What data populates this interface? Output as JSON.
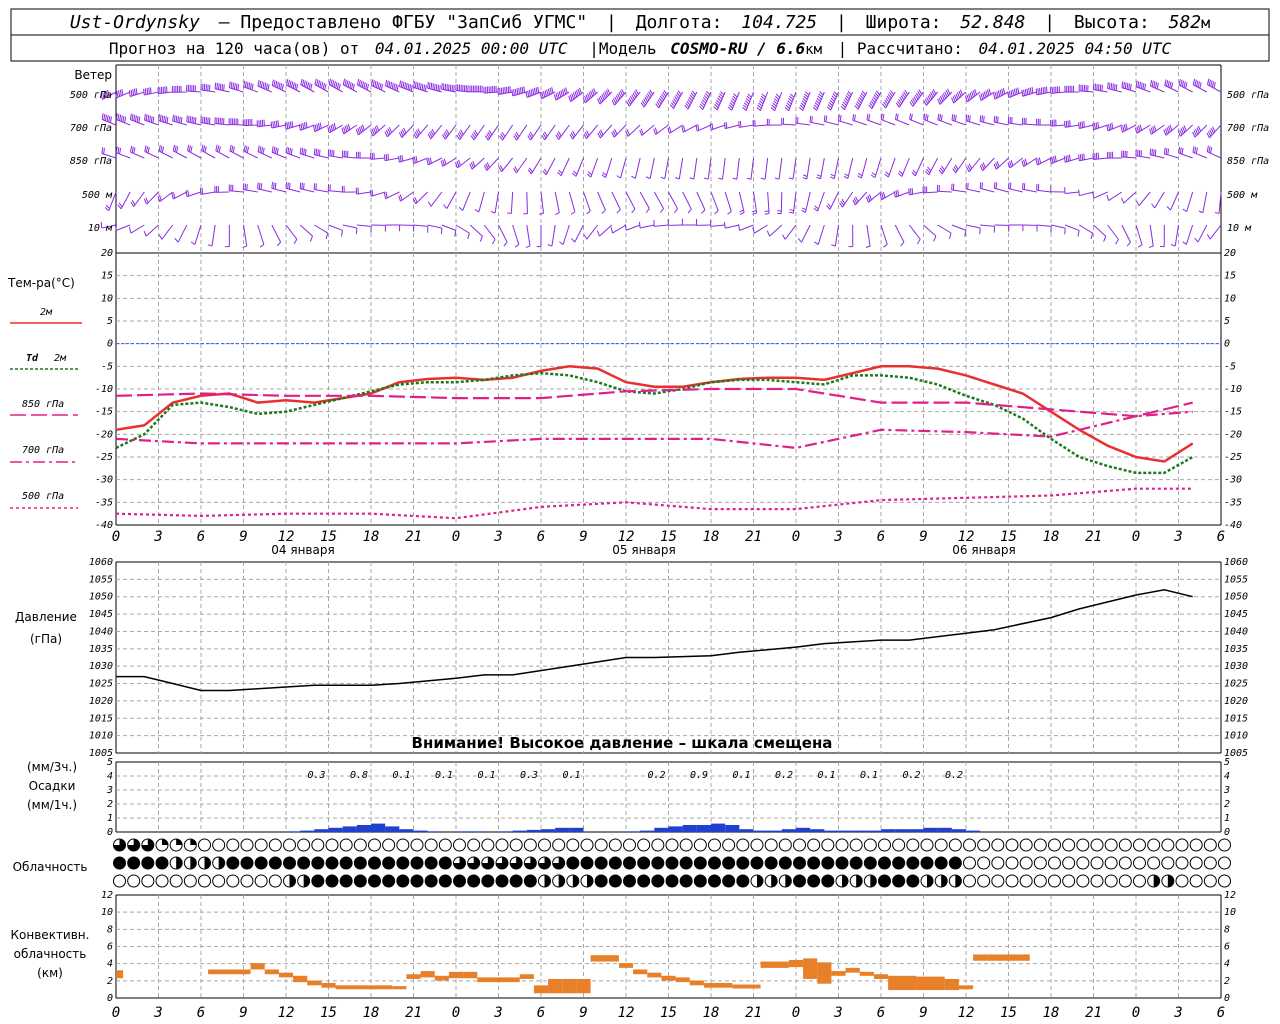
{
  "header": {
    "line1": {
      "station": "Ust-Ordynsky",
      "provided": "— Предоставлено ФГБУ \"ЗапСиб УГМС\"",
      "lon_label": "Долгота:",
      "lon": "104.725",
      "lat_label": "Широта:",
      "lat": "52.848",
      "alt_label": "Высота:",
      "alt": "582",
      "alt_unit": "м"
    },
    "line2": {
      "forecast": "Прогноз на 120 часа(ов) от",
      "run": "04.01.2025 00:00 UTC",
      "model_label": "|Модель",
      "model": "COSMO-RU / 6.6",
      "model_unit": "км",
      "calc_label": "| Рассчитано:",
      "calc": "04.01.2025 04:50 UTC"
    }
  },
  "wind_panel": {
    "title": "Ветер",
    "levels": [
      "500 гПа",
      "700 гПа",
      "850 гПа",
      "500 м",
      "10  м"
    ],
    "barb_color": "#8a2be2"
  },
  "temp_panel": {
    "title": "Тем-ра(°С)",
    "legend": [
      {
        "key": "t2m",
        "label": "2м",
        "color": "#e83030",
        "dash": ""
      },
      {
        "key": "td",
        "label_it": "Td",
        "label": "2м",
        "color": "#1c7a1c",
        "dash": "3 2"
      },
      {
        "key": "t850",
        "label": "850 гПа",
        "color": "#e0208a",
        "dash": "16 5"
      },
      {
        "key": "t700",
        "label": "700 гПа",
        "color": "#e0208a",
        "dash": "12 4 3 4"
      },
      {
        "key": "t500",
        "label": "500 гПа",
        "color": "#e0208a",
        "dash": "3 3"
      }
    ],
    "y_ticks": [
      "20",
      "15",
      "10",
      "5",
      "0",
      "-5",
      "-10",
      "-15",
      "-20",
      "-25",
      "-30",
      "-35",
      "-40"
    ],
    "dates": [
      "04 января",
      "05 января",
      "06 января"
    ]
  },
  "x_ticks": [
    "0",
    "3",
    "6",
    "9",
    "12",
    "15",
    "18",
    "21",
    "0",
    "3",
    "6",
    "9",
    "12",
    "15",
    "18",
    "21",
    "0",
    "3",
    "6",
    "9",
    "12",
    "15",
    "18",
    "21",
    "0",
    "3",
    "6"
  ],
  "pressure_panel": {
    "title": "Давление",
    "unit": "(гПа)",
    "y_ticks": [
      "1060",
      "1055",
      "1050",
      "1045",
      "1040",
      "1035",
      "1030",
      "1025",
      "1020",
      "1015",
      "1010",
      "1005"
    ],
    "warning": "Внимание! Высокое давление – шкала смещена"
  },
  "precip_panel": {
    "unit3": "(мм/3ч.)",
    "title": "Осадки",
    "unit1": "(мм/1ч.)",
    "y_ticks": [
      "5",
      "4",
      "3",
      "2",
      "1",
      "0"
    ],
    "color": "#2040d0",
    "amounts": [
      {
        "h": 15,
        "v": "0.3"
      },
      {
        "h": 18,
        "v": "0.8"
      },
      {
        "h": 21,
        "v": "0.1"
      },
      {
        "h": 24,
        "v": "0.1"
      },
      {
        "h": 27,
        "v": "0.1"
      },
      {
        "h": 30,
        "v": "0.3"
      },
      {
        "h": 33,
        "v": "0.1"
      },
      {
        "h": 39,
        "v": "0.2"
      },
      {
        "h": 42,
        "v": "0.9"
      },
      {
        "h": 45,
        "v": "0.1"
      },
      {
        "h": 48,
        "v": "0.2"
      },
      {
        "h": 51,
        "v": "0.1"
      },
      {
        "h": 54,
        "v": "0.1"
      },
      {
        "h": 57,
        "v": "0.2"
      },
      {
        "h": 60,
        "v": "0.2"
      }
    ]
  },
  "cloud_panel": {
    "title": "Облачность"
  },
  "conv_panel": {
    "title1": "Конвективн.",
    "title2": "облачность",
    "unit": "(км)",
    "y_ticks": [
      "12",
      "10",
      "8",
      "6",
      "4",
      "2",
      "0"
    ],
    "color": "#e8802a"
  },
  "chart_data": [
    {
      "type": "line",
      "title": "Тем-ра(°С)",
      "x_unit": "hours since 04.01.2025 00:00 UTC",
      "ylim": [
        -40,
        20
      ],
      "series": [
        {
          "name": "2м",
          "x": [
            0,
            2,
            4,
            6,
            8,
            10,
            12,
            14,
            16,
            18,
            20,
            22,
            24,
            26,
            28,
            30,
            32,
            34,
            36,
            38,
            40,
            42,
            44,
            46,
            48,
            50,
            52,
            54,
            56,
            58,
            60,
            62,
            64,
            66,
            68,
            70,
            72,
            74,
            76
          ],
          "values": [
            -19,
            -18,
            -13,
            -11.5,
            -11,
            -13,
            -12.5,
            -13,
            -12,
            -11,
            -8.5,
            -7.8,
            -7.5,
            -8,
            -7.5,
            -6,
            -5,
            -5.5,
            -8.5,
            -9.5,
            -9.5,
            -8.5,
            -7.8,
            -7.5,
            -7.5,
            -8,
            -6.5,
            -5,
            -5,
            -5.5,
            -7,
            -9,
            -11,
            -15,
            -19,
            -22.5,
            -25,
            -26,
            -22
          ]
        },
        {
          "name": "Td 2м",
          "x": [
            0,
            2,
            4,
            6,
            8,
            10,
            12,
            14,
            16,
            18,
            20,
            22,
            24,
            26,
            28,
            30,
            32,
            34,
            36,
            38,
            40,
            42,
            44,
            46,
            48,
            50,
            52,
            54,
            56,
            58,
            60,
            62,
            64,
            66,
            68,
            70,
            72,
            74,
            76
          ],
          "values": [
            -23,
            -20,
            -13.5,
            -13,
            -14,
            -15.5,
            -15,
            -13.5,
            -12,
            -10.5,
            -9,
            -8.5,
            -8.5,
            -8,
            -7,
            -6.5,
            -7,
            -8.5,
            -10.5,
            -11,
            -10,
            -8.5,
            -8,
            -8,
            -8.5,
            -9,
            -7,
            -7,
            -7.5,
            -9,
            -11.5,
            -13.5,
            -16.5,
            -21,
            -25,
            -27,
            -28.5,
            -28.5,
            -25
          ]
        },
        {
          "name": "850 гПа",
          "x": [
            0,
            6,
            12,
            18,
            24,
            30,
            36,
            42,
            48,
            54,
            60,
            66,
            72,
            76
          ],
          "values": [
            -11.5,
            -11,
            -11.5,
            -11.5,
            -12,
            -12,
            -10.5,
            -10,
            -10,
            -13,
            -13,
            -14.5,
            -16,
            -13
          ]
        },
        {
          "name": "700 гПа",
          "x": [
            0,
            6,
            12,
            18,
            24,
            30,
            36,
            42,
            48,
            54,
            60,
            66,
            72,
            76
          ],
          "values": [
            -21,
            -22,
            -22,
            -22,
            -22,
            -21,
            -21,
            -21,
            -23,
            -19,
            -19.5,
            -20.5,
            -16,
            -15
          ]
        },
        {
          "name": "500 гПа",
          "x": [
            0,
            6,
            12,
            18,
            24,
            30,
            36,
            42,
            48,
            54,
            60,
            66,
            72,
            76
          ],
          "values": [
            -37.5,
            -38,
            -37.5,
            -37.5,
            -38.5,
            -36,
            -35,
            -36.5,
            -36.5,
            -34.5,
            -34,
            -33.5,
            -32,
            -32
          ]
        }
      ]
    },
    {
      "type": "line",
      "title": "Давление",
      "ylabel": "(гПа)",
      "ylim": [
        1005,
        1060
      ],
      "series": [
        {
          "name": "Давление",
          "x": [
            0,
            2,
            4,
            6,
            8,
            12,
            14,
            18,
            20,
            24,
            26,
            28,
            32,
            36,
            38,
            42,
            44,
            48,
            50,
            54,
            56,
            60,
            62,
            66,
            68,
            72,
            74,
            76
          ],
          "values": [
            1027,
            1027,
            1025,
            1023,
            1023,
            1024,
            1024.5,
            1024.5,
            1025,
            1026.5,
            1027.5,
            1027.5,
            1030,
            1032.5,
            1032.5,
            1033,
            1034,
            1035.5,
            1036.5,
            1037.5,
            1037.5,
            1039.5,
            1040.5,
            1044,
            1046.5,
            1050.5,
            1052,
            1050
          ]
        }
      ]
    },
    {
      "type": "bar",
      "title": "Осадки",
      "ylabel": "(мм/1ч.)",
      "ylim": [
        0,
        5
      ],
      "x": [
        12,
        13,
        14,
        15,
        16,
        17,
        18,
        19,
        20,
        21,
        22,
        24,
        25,
        27,
        28,
        29,
        30,
        31,
        32,
        36,
        37,
        38,
        39,
        40,
        41,
        42,
        43,
        44,
        45,
        46,
        47,
        48,
        49,
        50,
        51,
        52,
        53,
        54,
        55,
        56,
        57,
        58,
        59,
        60
      ],
      "values": [
        0.05,
        0.1,
        0.2,
        0.3,
        0.4,
        0.5,
        0.6,
        0.4,
        0.2,
        0.1,
        0.05,
        0.05,
        0.05,
        0.05,
        0.1,
        0.15,
        0.2,
        0.3,
        0.3,
        0.05,
        0.1,
        0.3,
        0.4,
        0.5,
        0.5,
        0.6,
        0.5,
        0.2,
        0.1,
        0.1,
        0.2,
        0.3,
        0.2,
        0.1,
        0.1,
        0.1,
        0.1,
        0.2,
        0.2,
        0.2,
        0.3,
        0.3,
        0.2,
        0.1
      ]
    },
    {
      "type": "bar",
      "title": "Конвективн. облачность",
      "ylabel": "(км)",
      "ylim": [
        0,
        14
      ],
      "bars": [
        {
          "x0": 0,
          "x1": 0.5,
          "lo": 2.5,
          "hi": 3.5
        },
        {
          "x0": 6.5,
          "x1": 9.5,
          "lo": 3.0,
          "hi": 3.6
        },
        {
          "x0": 9.5,
          "x1": 10.5,
          "lo": 3.6,
          "hi": 4.4
        },
        {
          "x0": 10.5,
          "x1": 11.5,
          "lo": 3.0,
          "hi": 3.6
        },
        {
          "x0": 11.5,
          "x1": 12.5,
          "lo": 2.6,
          "hi": 3.2
        },
        {
          "x0": 12.5,
          "x1": 13.5,
          "lo": 2.0,
          "hi": 2.8
        },
        {
          "x0": 13.5,
          "x1": 14.5,
          "lo": 1.6,
          "hi": 2.2
        },
        {
          "x0": 14.5,
          "x1": 15.5,
          "lo": 1.3,
          "hi": 1.9
        },
        {
          "x0": 15.5,
          "x1": 19.5,
          "lo": 1.1,
          "hi": 1.6
        },
        {
          "x0": 19.5,
          "x1": 20.5,
          "lo": 1.1,
          "hi": 1.5
        },
        {
          "x0": 20.5,
          "x1": 21.5,
          "lo": 2.4,
          "hi": 3.0
        },
        {
          "x0": 21.5,
          "x1": 22.5,
          "lo": 2.6,
          "hi": 3.4
        },
        {
          "x0": 22.5,
          "x1": 23.5,
          "lo": 2.2,
          "hi": 2.8
        },
        {
          "x0": 23.5,
          "x1": 24.5,
          "lo": 2.5,
          "hi": 3.3
        },
        {
          "x0": 24.5,
          "x1": 25.5,
          "lo": 2.5,
          "hi": 3.3
        },
        {
          "x0": 25.5,
          "x1": 28.5,
          "lo": 2.0,
          "hi": 2.6
        },
        {
          "x0": 28.5,
          "x1": 29.5,
          "lo": 2.4,
          "hi": 3.0
        },
        {
          "x0": 29.5,
          "x1": 30.5,
          "lo": 0.6,
          "hi": 1.6
        },
        {
          "x0": 30.5,
          "x1": 31.5,
          "lo": 0.6,
          "hi": 2.4
        },
        {
          "x0": 31.5,
          "x1": 32.5,
          "lo": 0.6,
          "hi": 2.4
        },
        {
          "x0": 32.5,
          "x1": 33.5,
          "lo": 0.6,
          "hi": 2.4
        },
        {
          "x0": 33.5,
          "x1": 35.5,
          "lo": 4.6,
          "hi": 5.4
        },
        {
          "x0": 35.5,
          "x1": 36.5,
          "lo": 3.8,
          "hi": 4.4
        },
        {
          "x0": 36.5,
          "x1": 37.5,
          "lo": 3.0,
          "hi": 3.6
        },
        {
          "x0": 37.5,
          "x1": 38.5,
          "lo": 2.6,
          "hi": 3.2
        },
        {
          "x0": 38.5,
          "x1": 39.5,
          "lo": 2.2,
          "hi": 2.8
        },
        {
          "x0": 39.5,
          "x1": 40.5,
          "lo": 2.0,
          "hi": 2.6
        },
        {
          "x0": 40.5,
          "x1": 41.5,
          "lo": 1.6,
          "hi": 2.2
        },
        {
          "x0": 41.5,
          "x1": 43.5,
          "lo": 1.3,
          "hi": 1.9
        },
        {
          "x0": 43.5,
          "x1": 45.5,
          "lo": 1.2,
          "hi": 1.7
        },
        {
          "x0": 45.5,
          "x1": 47.5,
          "lo": 3.8,
          "hi": 4.6
        },
        {
          "x0": 47.5,
          "x1": 48.5,
          "lo": 3.9,
          "hi": 4.8
        },
        {
          "x0": 48.5,
          "x1": 49.5,
          "lo": 2.4,
          "hi": 5.0
        },
        {
          "x0": 49.5,
          "x1": 50.5,
          "lo": 1.8,
          "hi": 4.5
        },
        {
          "x0": 50.5,
          "x1": 51.5,
          "lo": 2.8,
          "hi": 3.4
        },
        {
          "x0": 51.5,
          "x1": 52.5,
          "lo": 3.2,
          "hi": 3.8
        },
        {
          "x0": 52.5,
          "x1": 53.5,
          "lo": 2.8,
          "hi": 3.3
        },
        {
          "x0": 53.5,
          "x1": 54.5,
          "lo": 2.4,
          "hi": 3.0
        },
        {
          "x0": 54.5,
          "x1": 56.5,
          "lo": 1.0,
          "hi": 2.8
        },
        {
          "x0": 56.5,
          "x1": 58.5,
          "lo": 1.0,
          "hi": 2.7
        },
        {
          "x0": 58.5,
          "x1": 59.5,
          "lo": 1.0,
          "hi": 2.4
        },
        {
          "x0": 59.5,
          "x1": 60.5,
          "lo": 1.1,
          "hi": 1.6
        },
        {
          "x0": 60.5,
          "x1": 61.5,
          "lo": 4.7,
          "hi": 5.5
        },
        {
          "x0": 61.5,
          "x1": 64.5,
          "lo": 4.7,
          "hi": 5.5
        }
      ]
    }
  ]
}
